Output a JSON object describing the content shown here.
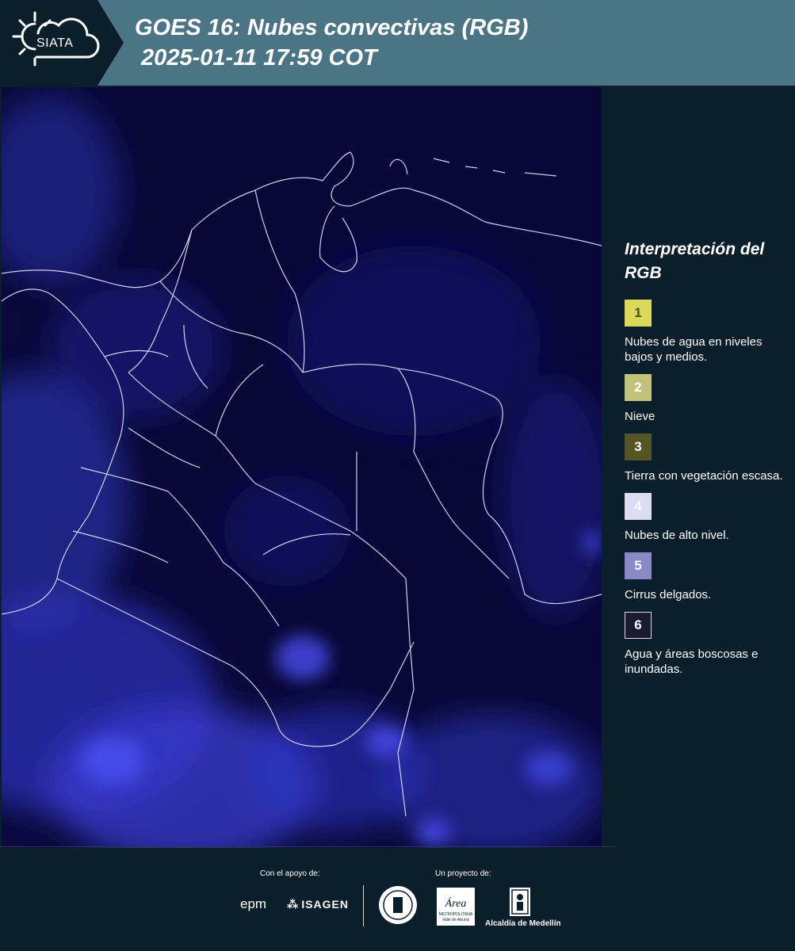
{
  "header": {
    "logo_text": "SIATA",
    "title": "GOES 16: Nubes convectivas (RGB)\n 2025-01-11 17:59 COT"
  },
  "legend": {
    "title": "Interpretación del RGB",
    "items": [
      {
        "num": "1",
        "label": "Nubes de agua en niveles bajos y medios.",
        "color": "#dcd85a",
        "text_color": "#4a4a1a"
      },
      {
        "num": "2",
        "label": "Nieve",
        "color": "#c3c27a",
        "text_color": "#ffffff"
      },
      {
        "num": "3",
        "label": "Tierra con vegetación escasa.",
        "color": "#555424",
        "text_color": "#ffffff"
      },
      {
        "num": "4",
        "label": "Nubes de alto nivel.",
        "color": "#dcdcf2",
        "text_color": "#ffffff"
      },
      {
        "num": "5",
        "label": "Cirrus delgados.",
        "color": "#8a89c8",
        "text_color": "#ffffff"
      },
      {
        "num": "6",
        "label": "Agua y áreas boscosas e inundadas.",
        "color": "#1c1a2e",
        "text_color": "#ffffff"
      }
    ]
  },
  "footer": {
    "support_label": "Con el apoyo de:",
    "project_label": "Un proyecto de:",
    "sponsor1": "epm",
    "sponsor2": "ISAGEN",
    "partner_area": "Área",
    "partner_area_sub1": "METROPOLITANA",
    "partner_area_sub2": "Valle de Aburrá",
    "partner_alcaldia": "Alcaldía de Medellín"
  }
}
